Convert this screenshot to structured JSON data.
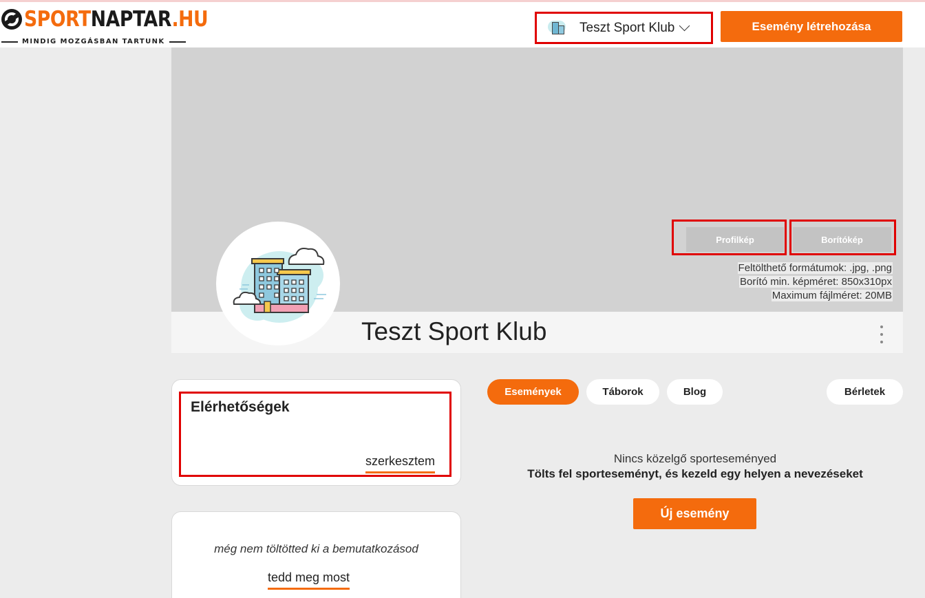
{
  "header": {
    "logo": {
      "part1": "SPORT",
      "part2": "NAPTAR",
      "part3": ".HU",
      "tagline": "MINDIG MOZGÁSBAN TARTUNK"
    },
    "club_selector": {
      "value": "Teszt Sport Klub",
      "icon": "building-icon"
    },
    "create_event_label": "Esemény létrehozása"
  },
  "cover": {
    "profile_photo_label": "Profilkép",
    "cover_photo_label": "Borítókép",
    "info": [
      "Feltölthető formátumok: .jpg, .png",
      "Borító min. képméret: 850x310px",
      "Maximum fájlméret: 20MB"
    ]
  },
  "profile": {
    "title": "Teszt Sport Klub",
    "avatar_icon": "building-illustration"
  },
  "contact": {
    "title": "Elérhetőségek",
    "edit_label": "szerkesztem"
  },
  "intro": {
    "text": "még nem töltötted ki a bemutatkozásod",
    "link_label": "tedd meg most"
  },
  "tabs": [
    {
      "label": "Események",
      "active": true
    },
    {
      "label": "Táborok",
      "active": false
    },
    {
      "label": "Blog",
      "active": false
    },
    {
      "label": "Bérletek",
      "active": false
    }
  ],
  "events_empty": {
    "line1": "Nincs közelgő sporteseményed",
    "line2": "Tölts fel sporteseményt, és kezeld egy helyen a nevezéseket",
    "button_label": "Új esemény"
  },
  "colors": {
    "accent": "#f46b0d",
    "highlight": "#e00000",
    "background": "#ececec"
  }
}
